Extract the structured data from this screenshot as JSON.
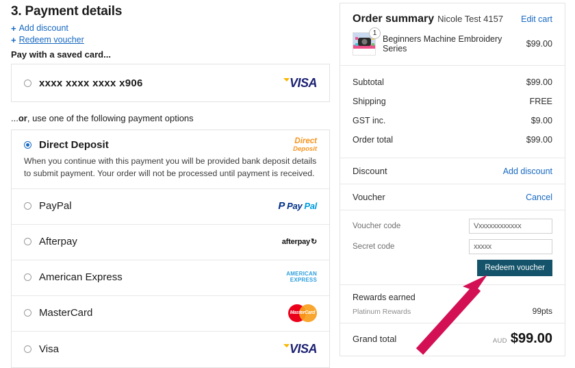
{
  "payment": {
    "title": "3. Payment details",
    "links": [
      {
        "label": "Add discount",
        "icon": "plus-icon",
        "underlined": false
      },
      {
        "label": "Redeem voucher",
        "icon": "plus-icon",
        "underlined": true
      }
    ],
    "saved_card_label": "Pay with a saved card...",
    "saved_card": {
      "number": "xxxx xxxx xxxx x906",
      "logo": "visa-logo",
      "selected": false
    },
    "or_prefix": "...",
    "or_bold": "or",
    "or_suffix": ", use one of the following payment options",
    "options": [
      {
        "label": "Direct Deposit",
        "selected": true,
        "logo": "direct-deposit-logo",
        "logo_line1": "Direct",
        "logo_line2": "Deposit",
        "description": "When you continue with this payment you will be provided bank deposit details to submit payment. Your order will not be processed until payment is received."
      },
      {
        "label": "PayPal",
        "selected": false,
        "logo": "paypal-logo",
        "logo_text_1": "Pay",
        "logo_text_2": "Pal",
        "description": ""
      },
      {
        "label": "Afterpay",
        "selected": false,
        "logo": "afterpay-logo",
        "logo_text": "afterpay",
        "description": ""
      },
      {
        "label": "American Express",
        "selected": false,
        "logo": "amex-logo",
        "logo_line1": "AMERICAN",
        "logo_line2": "EXPRESS",
        "description": ""
      },
      {
        "label": "MasterCard",
        "selected": false,
        "logo": "mastercard-logo",
        "logo_text": "MasterCard",
        "description": ""
      },
      {
        "label": "Visa",
        "selected": false,
        "logo": "visa-logo",
        "description": ""
      }
    ]
  },
  "summary": {
    "title": "Order summary",
    "customer": "Nicole Test 4157",
    "edit_cart": "Edit cart",
    "product": {
      "name": "Beginners Machine Embroidery Series",
      "price": "$99.00",
      "quantity": "1"
    },
    "totals": [
      {
        "label": "Subtotal",
        "value": "$99.00"
      },
      {
        "label": "Shipping",
        "value": "FREE"
      },
      {
        "label": "GST inc.",
        "value": "$9.00"
      },
      {
        "label": "Order total",
        "value": "$99.00"
      }
    ],
    "discount": {
      "label": "Discount",
      "action": "Add discount"
    },
    "voucher": {
      "label": "Voucher",
      "action": "Cancel"
    },
    "voucher_form": {
      "code_label": "Voucher code",
      "code_value": "Vxxxxxxxxxxxx",
      "secret_label": "Secret code",
      "secret_value": "xxxxx",
      "submit_label": "Redeem voucher"
    },
    "rewards": {
      "title": "Rewards earned",
      "program": "Platinum Rewards",
      "points": "99pts"
    },
    "grand_total": {
      "label": "Grand total",
      "currency": "AUD",
      "amount": "$99.00"
    }
  },
  "annotation": {
    "arrow_color": "#D31054",
    "target": "redeem-voucher-button"
  }
}
